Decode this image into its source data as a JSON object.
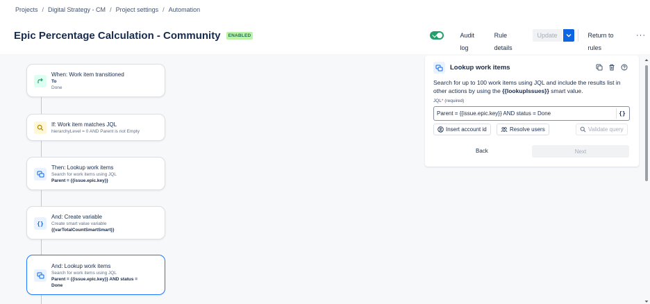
{
  "breadcrumb": {
    "items": [
      "Projects",
      "Digital Strategy - CM",
      "Project settings",
      "Automation"
    ],
    "separator": "/"
  },
  "header": {
    "title": "Epic Percentage Calculation - Community",
    "status_badge": "ENABLED",
    "toggle_on": true,
    "audit_log": "Audit log",
    "rule_details": "Rule details",
    "update": "Update",
    "return_to_rules": "Return to rules",
    "more": "···"
  },
  "flow": {
    "cards": [
      {
        "title": "When: Work item transitioned",
        "line1": "To",
        "line2": "Done",
        "icon": "transition-icon",
        "color": "#22a06b"
      },
      {
        "title": "If: Work item matches JQL",
        "line1": "hierarchyLevel = 0 AND Parent is not Empty",
        "icon": "search-icon",
        "color": "#b38600"
      },
      {
        "title": "Then: Lookup work items",
        "line1": "Search for work items using JQL",
        "line2": "Parent = {{issue.epic.key}}",
        "icon": "lookup-icon",
        "color": "#0c66e4"
      },
      {
        "title": "And: Create variable",
        "line1": "Create smart value variable",
        "line2": "{{varTotalCountSmartSmart}}",
        "icon": "braces-icon",
        "color": "#0c66e4"
      },
      {
        "title": "And: Lookup work items",
        "line1": "Search for work items using JQL",
        "line2": "Parent = {{issue.epic.key}} AND status =",
        "line3": "Done",
        "icon": "lookup-icon",
        "color": "#0c66e4"
      }
    ]
  },
  "panel": {
    "title": "Lookup work items",
    "desc_part1": "Search for up to 100 work items using JQL and include the results list in other actions by using the ",
    "desc_bold": "{{lookupIssues}}",
    "desc_part2": " smart value.",
    "jql_label": "JQL",
    "required_mark": "*",
    "required_text": "(required)",
    "jql_value": "Parent = {{issue.epic.key}} AND status = Done",
    "smart_value_btn": "{}",
    "insert_account_id": "Insert account id",
    "resolve_users": "Resolve users",
    "validate_query": "Validate query",
    "back": "Back",
    "next": "Next"
  },
  "colors": {
    "accent": "#0c66e4",
    "toggle": "#22a06b",
    "badge_bg": "#baf3a7",
    "badge_text": "#216e4e",
    "selected_border": "#1d7afc"
  }
}
